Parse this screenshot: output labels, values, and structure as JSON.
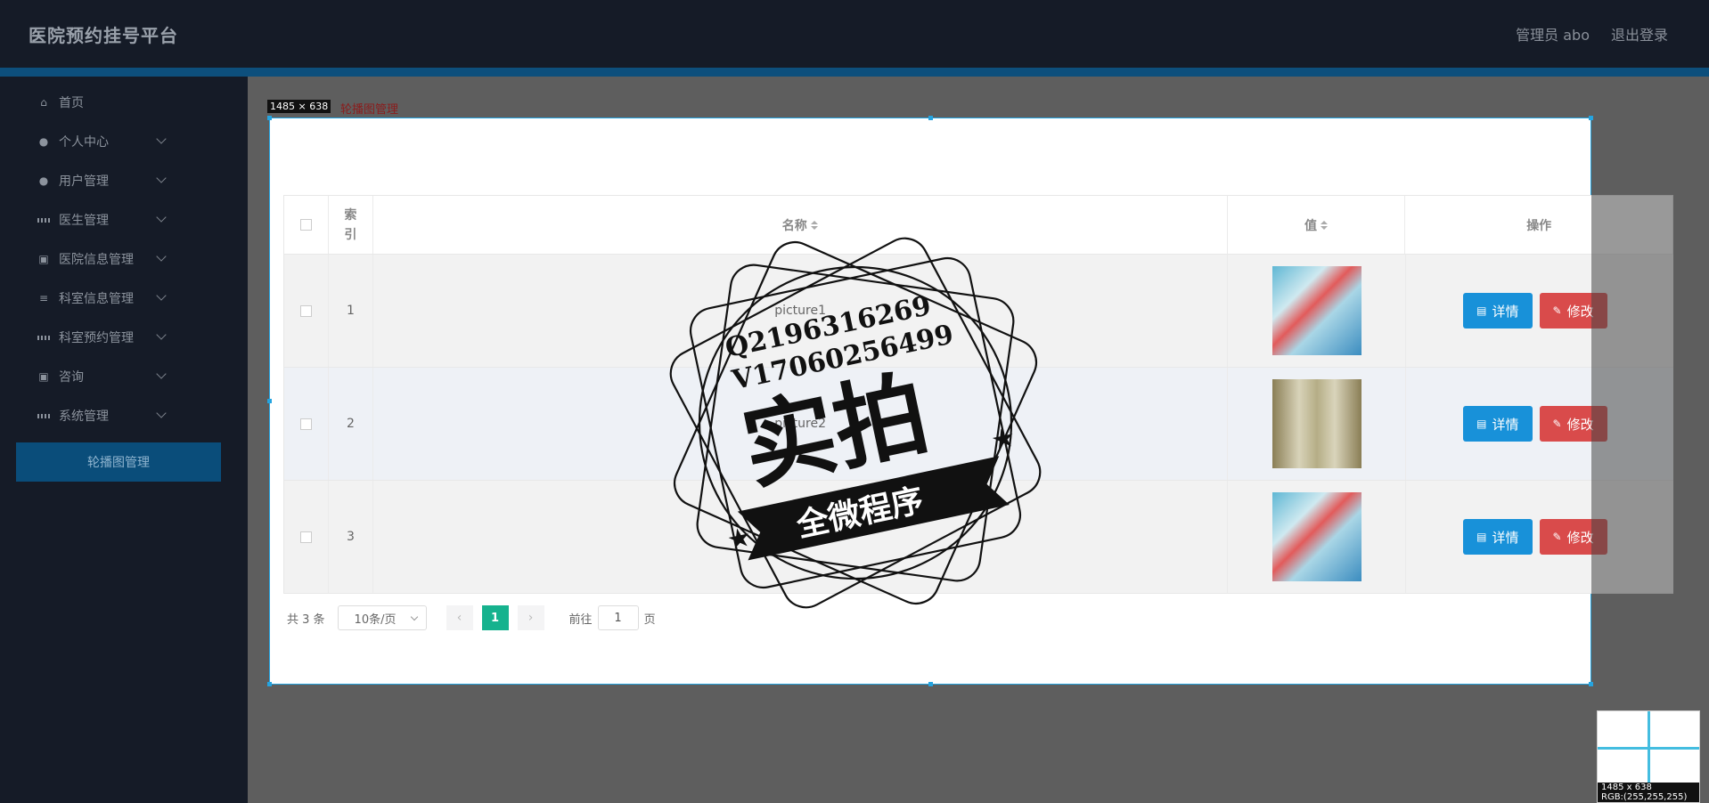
{
  "header": {
    "brand": "医院预约挂号平台",
    "user": "管理员 abo",
    "logout": "退出登录"
  },
  "sidebar": {
    "items": [
      {
        "label": "首页",
        "icon": "home-icon",
        "has_submenu": false
      },
      {
        "label": "个人中心",
        "icon": "user-icon",
        "has_submenu": true
      },
      {
        "label": "用户管理",
        "icon": "user-icon",
        "has_submenu": true
      },
      {
        "label": "医生管理",
        "icon": "grid-icon",
        "has_submenu": true
      },
      {
        "label": "医院信息管理",
        "icon": "clipboard-icon",
        "has_submenu": true
      },
      {
        "label": "科室信息管理",
        "icon": "list-icon",
        "has_submenu": true
      },
      {
        "label": "科室预约管理",
        "icon": "grid-icon",
        "has_submenu": true
      },
      {
        "label": "咨询",
        "icon": "clipboard-icon",
        "has_submenu": true
      },
      {
        "label": "系统管理",
        "icon": "grid-icon",
        "has_submenu": true
      }
    ],
    "active_sub": "轮播图管理"
  },
  "breadcrumb": "轮播图管理",
  "size_tag": "1485 × 638",
  "table": {
    "headers": {
      "index": "索引",
      "name": "名称",
      "value": "值",
      "ops": "操作"
    },
    "rows": [
      {
        "index": "1",
        "name": "picture1",
        "thumb": "a"
      },
      {
        "index": "2",
        "name": "picture2",
        "thumb": "b"
      },
      {
        "index": "3",
        "name": "picture3",
        "thumb": "a"
      }
    ],
    "detail_label": "详情",
    "edit_label": "修改"
  },
  "pager": {
    "total": "共 3 条",
    "page_size": "10条/页",
    "current": "1",
    "goto_prefix": "前往",
    "goto_value": "1",
    "goto_suffix": "页"
  },
  "watermark": {
    "line1": "Q2196316269",
    "line2": "V17060256499",
    "big": "实拍",
    "ribbon": "全微程序"
  },
  "magnifier": {
    "size": "1485 x 638",
    "rgb": "RGB:(255,255,255)"
  },
  "colors": {
    "header_bg": "#151b27",
    "accent_blue": "#1891d9",
    "danger_red": "#d94b4b",
    "page_active": "#16b28e",
    "selection": "#25a4e0"
  }
}
